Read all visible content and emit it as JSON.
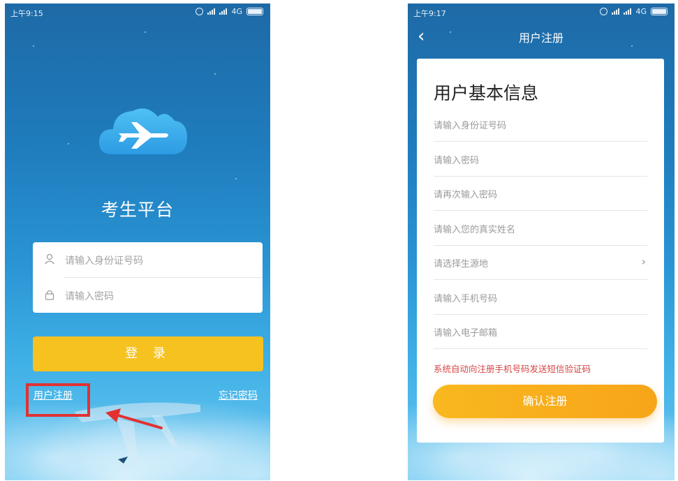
{
  "login_screen": {
    "status_bar": {
      "time": "上午9:15",
      "network": "4G"
    },
    "app_title": "考生平台",
    "id_input_placeholder": "请输入身份证号码",
    "password_input_placeholder": "请输入密码",
    "login_button": "登 录",
    "register_link": "用户注册",
    "forgot_password_link": "忘记密码",
    "highlight_color": "#e23131"
  },
  "register_screen": {
    "status_bar": {
      "time": "上午9:17",
      "network": "4G"
    },
    "nav_title": "用户注册",
    "section_heading": "用户基本信息",
    "fields": [
      {
        "placeholder": "请输入身份证号码"
      },
      {
        "placeholder": "请输入密码"
      },
      {
        "placeholder": "请再次输入密码"
      },
      {
        "placeholder": "请输入您的真实姓名"
      },
      {
        "placeholder": "请选择生源地"
      },
      {
        "placeholder": "请输入手机号码"
      },
      {
        "placeholder": "请输入电子邮箱"
      }
    ],
    "notice": "系统自动向注册手机号码发送短信验证码",
    "confirm_button": "确认注册",
    "accent_color": "#f7a51a"
  }
}
